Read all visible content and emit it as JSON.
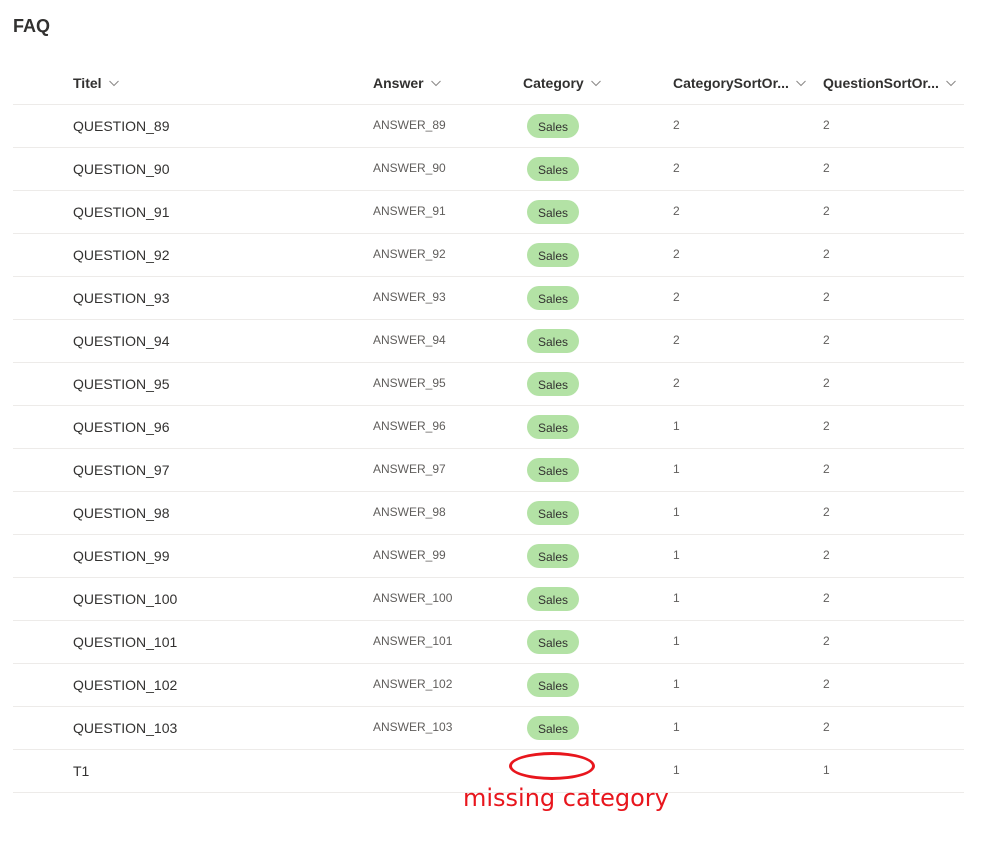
{
  "page": {
    "title": "FAQ"
  },
  "columns": {
    "title": "Titel",
    "answer": "Answer",
    "category": "Category",
    "category_sort": "CategorySortOr...",
    "question_sort": "QuestionSortOr..."
  },
  "rows": [
    {
      "title": "QUESTION_89",
      "answer": "ANSWER_89",
      "category": "Sales",
      "category_sort": "2",
      "question_sort": "2"
    },
    {
      "title": "QUESTION_90",
      "answer": "ANSWER_90",
      "category": "Sales",
      "category_sort": "2",
      "question_sort": "2"
    },
    {
      "title": "QUESTION_91",
      "answer": "ANSWER_91",
      "category": "Sales",
      "category_sort": "2",
      "question_sort": "2"
    },
    {
      "title": "QUESTION_92",
      "answer": "ANSWER_92",
      "category": "Sales",
      "category_sort": "2",
      "question_sort": "2"
    },
    {
      "title": "QUESTION_93",
      "answer": "ANSWER_93",
      "category": "Sales",
      "category_sort": "2",
      "question_sort": "2"
    },
    {
      "title": "QUESTION_94",
      "answer": "ANSWER_94",
      "category": "Sales",
      "category_sort": "2",
      "question_sort": "2"
    },
    {
      "title": "QUESTION_95",
      "answer": "ANSWER_95",
      "category": "Sales",
      "category_sort": "2",
      "question_sort": "2"
    },
    {
      "title": "QUESTION_96",
      "answer": "ANSWER_96",
      "category": "Sales",
      "category_sort": "1",
      "question_sort": "2"
    },
    {
      "title": "QUESTION_97",
      "answer": "ANSWER_97",
      "category": "Sales",
      "category_sort": "1",
      "question_sort": "2"
    },
    {
      "title": "QUESTION_98",
      "answer": "ANSWER_98",
      "category": "Sales",
      "category_sort": "1",
      "question_sort": "2"
    },
    {
      "title": "QUESTION_99",
      "answer": "ANSWER_99",
      "category": "Sales",
      "category_sort": "1",
      "question_sort": "2"
    },
    {
      "title": "QUESTION_100",
      "answer": "ANSWER_100",
      "category": "Sales",
      "category_sort": "1",
      "question_sort": "2"
    },
    {
      "title": "QUESTION_101",
      "answer": "ANSWER_101",
      "category": "Sales",
      "category_sort": "1",
      "question_sort": "2"
    },
    {
      "title": "QUESTION_102",
      "answer": "ANSWER_102",
      "category": "Sales",
      "category_sort": "1",
      "question_sort": "2"
    },
    {
      "title": "QUESTION_103",
      "answer": "ANSWER_103",
      "category": "Sales",
      "category_sort": "1",
      "question_sort": "2"
    },
    {
      "title": "T1",
      "answer": "",
      "category": "",
      "category_sort": "1",
      "question_sort": "1"
    }
  ],
  "annotation": {
    "text": "missing category",
    "color": "#e8161d"
  },
  "colors": {
    "pill_background": "#b3e2a5",
    "divider": "#edebe9",
    "text_primary": "#323130",
    "text_secondary": "#605e5c"
  },
  "icons": {
    "column_menu": "chevron-down-icon"
  }
}
